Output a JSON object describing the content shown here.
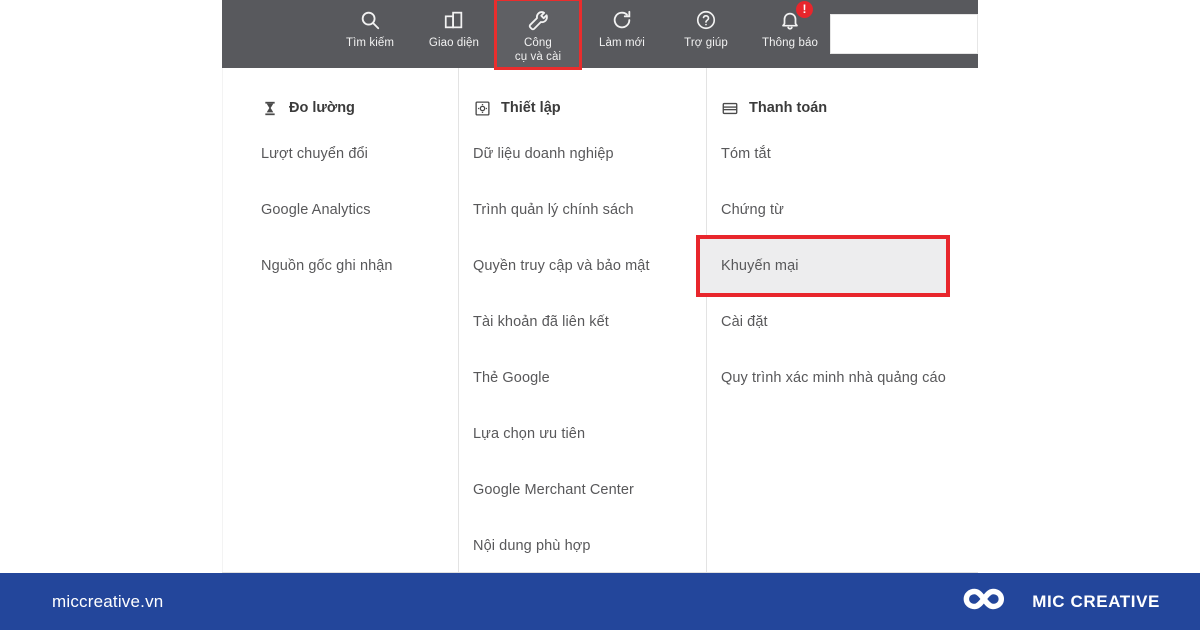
{
  "toolbar": {
    "background_color": "#58595d",
    "active_highlight_color": "#ea2d2d",
    "items": [
      {
        "label": "Tìm kiếm",
        "icon": "search-icon",
        "active": false
      },
      {
        "label": "Giao diện",
        "icon": "reports-chart-icon",
        "active": false
      },
      {
        "label": "Công\ncụ và cài",
        "label_line1": "Công",
        "label_line2": "cụ và cài",
        "icon": "wrench-tools-icon",
        "active": true
      },
      {
        "label": "Làm mới",
        "icon": "refresh-icon",
        "active": false
      },
      {
        "label": "Trợ giúp",
        "icon": "help-question-icon",
        "active": false
      },
      {
        "label": "Thông báo",
        "icon": "bell-notification-icon",
        "active": false,
        "badge": "!"
      }
    ],
    "search_input_value": "",
    "search_input_placeholder": ""
  },
  "menu": {
    "columns": [
      {
        "title": "Đo lường",
        "icon": "measurement-hourglass-icon",
        "items": [
          {
            "label": "Lượt chuyển đổi",
            "highlighted": false
          },
          {
            "label": "Google Analytics",
            "highlighted": false
          },
          {
            "label": "Nguồn gốc ghi nhận",
            "highlighted": false
          }
        ]
      },
      {
        "title": "Thiết lập",
        "icon": "settings-square-icon",
        "items": [
          {
            "label": "Dữ liệu doanh nghiệp",
            "highlighted": false
          },
          {
            "label": "Trình quản lý chính sách",
            "highlighted": false
          },
          {
            "label": "Quyền truy cập và bảo mật",
            "highlighted": false
          },
          {
            "label": "Tài khoản đã liên kết",
            "highlighted": false
          },
          {
            "label": "Thẻ Google",
            "highlighted": false
          },
          {
            "label": "Lựa chọn ưu tiên",
            "highlighted": false
          },
          {
            "label": "Google Merchant Center",
            "highlighted": false
          },
          {
            "label": "Nội dung phù hợp",
            "highlighted": false
          }
        ]
      },
      {
        "title": "Thanh toán",
        "icon": "credit-card-icon",
        "items": [
          {
            "label": "Tóm tắt",
            "highlighted": false
          },
          {
            "label": "Chứng từ",
            "highlighted": false
          },
          {
            "label": "Khuyến mại",
            "highlighted": true
          },
          {
            "label": "Cài đặt",
            "highlighted": false
          },
          {
            "label": "Quy trình xác minh nhà quảng cáo",
            "highlighted": false
          }
        ]
      }
    ],
    "highlight_border_color": "#e8262c",
    "highlight_background_color": "#ededee"
  },
  "footer": {
    "url": "miccreative.vn",
    "brand_name": "MIC CREATIVE",
    "logo_icon": "infinity-loop-logo-icon",
    "background_color": "#23469b"
  }
}
